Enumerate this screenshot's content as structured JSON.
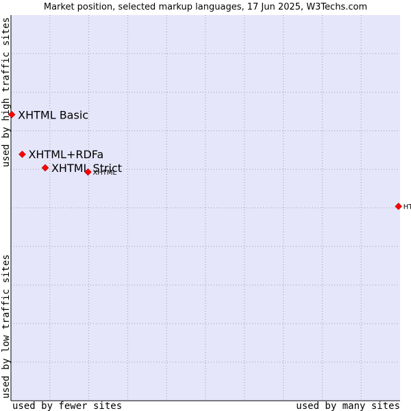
{
  "chart_data": {
    "type": "scatter",
    "title": "Market position, selected markup languages, 17 Jun 2025, W3Techs.com",
    "xlabel_left": "used by fewer sites",
    "xlabel_right": "used by many sites",
    "ylabel_bottom": "used by low traffic sites",
    "ylabel_top": "used by high traffic sites",
    "xlim": [
      0,
      100
    ],
    "ylim": [
      0,
      100
    ],
    "grid": true,
    "colors": {
      "plot_background": "#e6e6fa",
      "grid": "#9a9aac",
      "marker": "#ff0000",
      "marker_edge": "#990000"
    },
    "points": [
      {
        "label": "XHTML Basic",
        "x": 0.2,
        "y": 74.2,
        "label_size": "big"
      },
      {
        "label": "XHTML+RDFa",
        "x": 2.9,
        "y": 63.9,
        "label_size": "big"
      },
      {
        "label": "XHTML Strict",
        "x": 8.8,
        "y": 60.4,
        "label_size": "big"
      },
      {
        "label": "XHTML",
        "x": 19.8,
        "y": 59.3,
        "label_size": "small"
      },
      {
        "label": "HTML",
        "x": 99.6,
        "y": 50.4,
        "label_size": "small"
      }
    ]
  }
}
